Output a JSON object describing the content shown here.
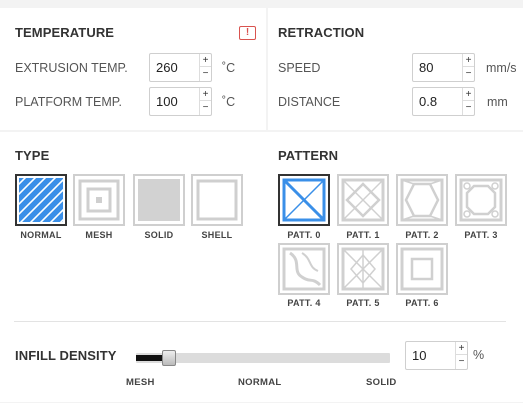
{
  "temperature": {
    "title": "TEMPERATURE",
    "warning_icon": "!",
    "extrusion_label": "EXTRUSION TEMP.",
    "extrusion_value": "260",
    "extrusion_unit": "˚C",
    "platform_label": "PLATFORM TEMP.",
    "platform_value": "100",
    "platform_unit": "˚C"
  },
  "retraction": {
    "title": "RETRACTION",
    "speed_label": "SPEED",
    "speed_value": "80",
    "speed_unit": "mm/s",
    "distance_label": "DISTANCE",
    "distance_value": "0.8",
    "distance_unit": "mm"
  },
  "spinner": {
    "up": "+",
    "down": "−"
  },
  "type": {
    "title": "TYPE",
    "selected": "NORMAL",
    "options": [
      "NORMAL",
      "MESH",
      "SOLID",
      "SHELL"
    ]
  },
  "pattern": {
    "title": "PATTERN",
    "selected": "PATT. 0",
    "options": [
      "PATT. 0",
      "PATT. 1",
      "PATT. 2",
      "PATT. 3",
      "PATT. 4",
      "PATT. 5",
      "PATT. 6"
    ]
  },
  "infill": {
    "title": "INFILL DENSITY",
    "value": "10",
    "unit": "%",
    "slider_fraction": 0.13,
    "marks": [
      "MESH",
      "NORMAL",
      "SOLID"
    ]
  },
  "colors": {
    "accent": "#3a8fe8",
    "warning": "#d9534f",
    "tile_border": "#cfcfcf"
  }
}
